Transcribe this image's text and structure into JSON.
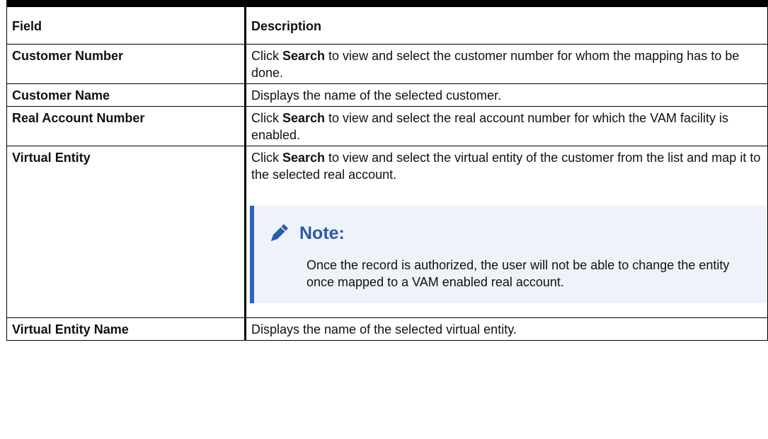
{
  "table": {
    "headers": {
      "field": "Field",
      "description": "Description"
    },
    "rows": [
      {
        "field": "Customer Number",
        "desc_pre": "Click ",
        "desc_bold": "Search",
        "desc_post": " to view and select the customer number for whom the mapping has to be done."
      },
      {
        "field": "Customer Name",
        "desc": "Displays the name of the selected customer."
      },
      {
        "field": "Real Account Number",
        "desc_pre": "Click ",
        "desc_bold": "Search",
        "desc_post": " to view and select the real account number for which the VAM facility is enabled."
      },
      {
        "field": "Virtual Entity",
        "desc_pre": "Click ",
        "desc_bold": "Search",
        "desc_post": " to view and select the virtual entity of the customer from the list and map it to the selected real account.",
        "note": {
          "icon": "pencil-icon",
          "title": "Note:",
          "text": "Once the record is authorized, the user will not be able to change the entity once mapped to a VAM enabled real account."
        }
      },
      {
        "field": "Virtual Entity Name",
        "desc": "Displays the name of the selected virtual entity."
      }
    ]
  },
  "colors": {
    "note_accent": "#3262c0",
    "note_background": "#eef3fa",
    "note_title": "#2a5aa8"
  }
}
